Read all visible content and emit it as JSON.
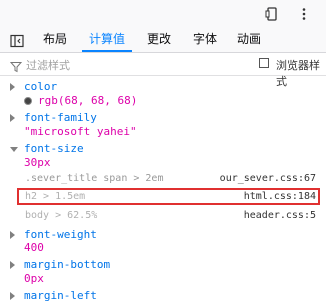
{
  "toolbar": {
    "icons": [
      "responsive-icon",
      "more-icon"
    ]
  },
  "tabs": [
    {
      "label": "布局",
      "active": false
    },
    {
      "label": "计算值",
      "active": true
    },
    {
      "label": "更改",
      "active": false
    },
    {
      "label": "字体",
      "active": false
    },
    {
      "label": "动画",
      "active": false
    }
  ],
  "filter": {
    "placeholder": "过滤样式",
    "browser_styles_label": "浏览器样式",
    "browser_styles_checked": false
  },
  "properties": [
    {
      "name": "color",
      "value": "rgb(68, 68, 68)",
      "expanded": false,
      "swatch_color": "#444444"
    },
    {
      "name": "font-family",
      "value": "\"microsoft yahei\"",
      "expanded": false
    },
    {
      "name": "font-size",
      "value": "30px",
      "expanded": true,
      "rules": [
        {
          "selector": ".sever_title span > 2em",
          "source": "our_sever.css:67"
        },
        {
          "selector": "h2 > 1.5em",
          "source": "html.css:184"
        },
        {
          "selector": "body > 62.5%",
          "source": "header.css:5"
        }
      ]
    },
    {
      "name": "font-weight",
      "value": "400",
      "expanded": false
    },
    {
      "name": "margin-bottom",
      "value": "0px",
      "expanded": false
    },
    {
      "name": "margin-left",
      "value": "",
      "expanded": false
    }
  ],
  "colors": {
    "accent": "#0a84ff",
    "property": "#0074e8",
    "value": "#dd00a9",
    "highlight_border": "#e03030"
  }
}
